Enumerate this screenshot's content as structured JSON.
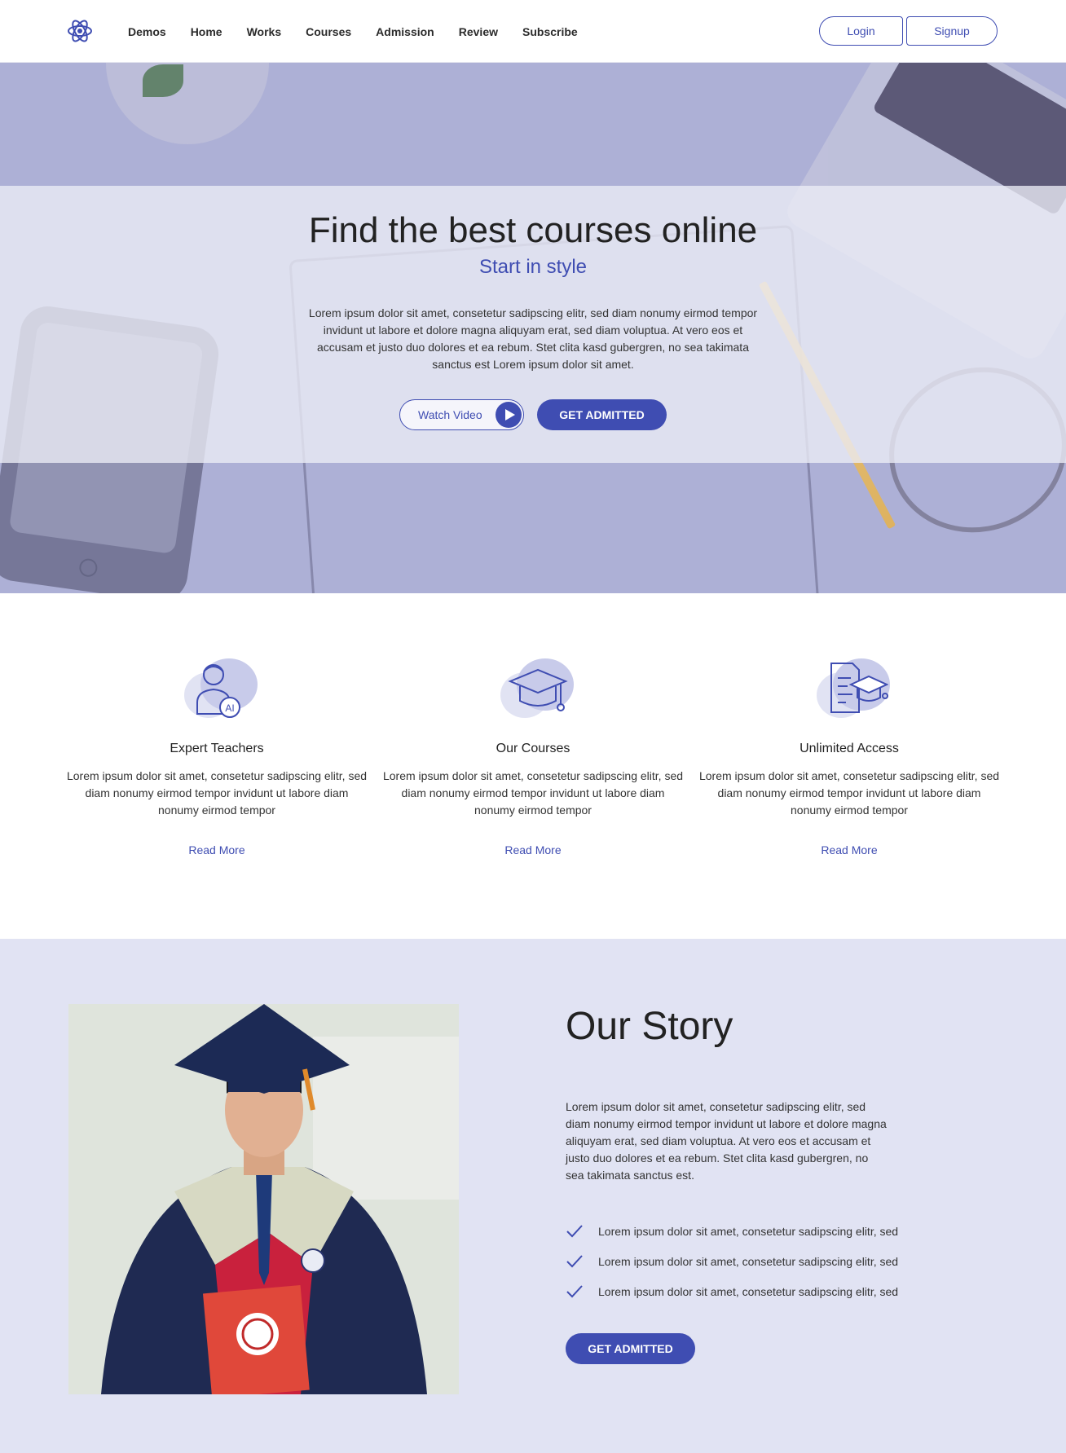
{
  "nav": {
    "links": [
      "Demos",
      "Home",
      "Works",
      "Courses",
      "Admission",
      "Review",
      "Subscribe"
    ],
    "login": "Login",
    "signup": "Signup"
  },
  "hero": {
    "title": "Find the best courses online",
    "subtitle": "Start in style",
    "text": "Lorem ipsum dolor sit amet, consetetur sadipscing elitr, sed diam nonumy eirmod tempor invidunt ut labore et dolore magna aliquyam erat, sed diam voluptua. At vero eos et accusam et justo duo dolores et ea rebum. Stet clita kasd gubergren, no sea takimata sanctus est Lorem ipsum dolor sit amet.",
    "watch_label": "Watch Video",
    "admit_label": "GET ADMITTED"
  },
  "features": [
    {
      "title": "Expert Teachers",
      "icon": "teacher-icon",
      "badge": "AI",
      "text": "Lorem ipsum dolor sit amet, consetetur sadipscing elitr, sed diam nonumy eirmod tempor invidunt ut labore diam nonumy eirmod tempor",
      "link": "Read More"
    },
    {
      "title": "Our Courses",
      "icon": "graduation-cap-icon",
      "text": "Lorem ipsum dolor sit amet, consetetur sadipscing elitr, sed diam nonumy eirmod tempor invidunt ut labore diam nonumy eirmod tempor",
      "link": "Read More"
    },
    {
      "title": "Unlimited Access",
      "icon": "document-cap-icon",
      "text": "Lorem ipsum dolor sit amet, consetetur sadipscing elitr, sed diam nonumy eirmod tempor invidunt ut labore diam nonumy eirmod tempor",
      "link": "Read More"
    }
  ],
  "story": {
    "title": "Our Story",
    "text": "Lorem ipsum dolor sit amet, consetetur sadipscing elitr, sed diam nonumy eirmod tempor invidunt ut labore et dolore magna aliquyam erat, sed diam voluptua. At vero eos et accusam et justo duo dolores et ea rebum. Stet clita kasd gubergren, no sea takimata sanctus est.",
    "checks": [
      "Lorem ipsum dolor sit amet, consetetur sadipscing elitr, sed",
      "Lorem ipsum dolor sit amet, consetetur sadipscing elitr, sed",
      "Lorem ipsum dolor sit amet, consetetur sadipscing elitr, sed"
    ],
    "admit_label": "GET ADMITTED"
  },
  "colors": {
    "accent": "#3f4db2",
    "hero_overlay": "#adb0d6",
    "story_bg": "#e1e3f3"
  }
}
